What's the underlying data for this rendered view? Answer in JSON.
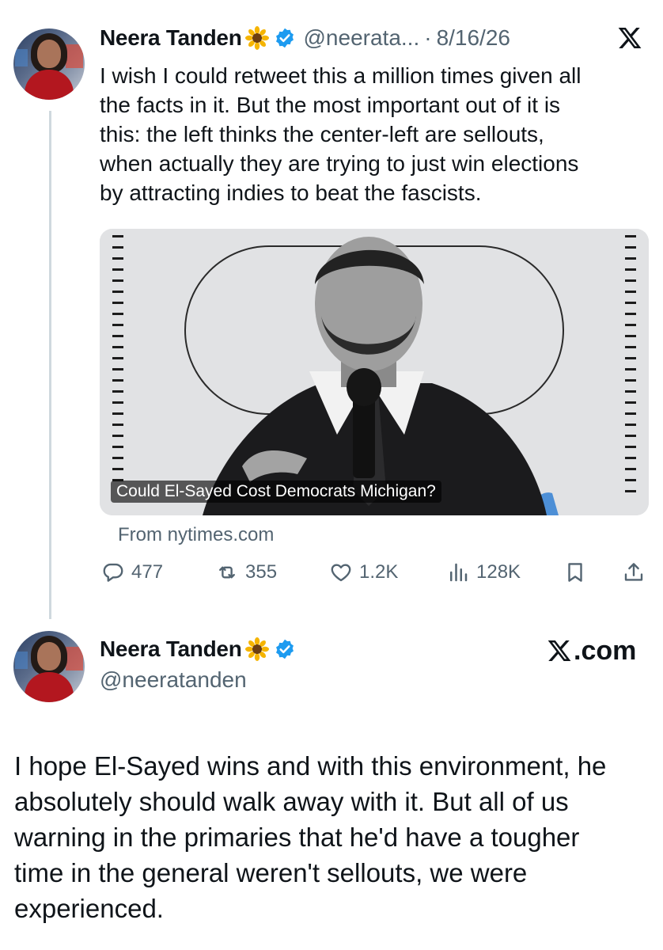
{
  "post": {
    "author_name": "Neera Tanden",
    "handle_truncated": "@neerata...",
    "separator": "·",
    "date": "8/16/26",
    "text_lines": [
      "I wish I could retweet this a million times given all",
      "the facts in it.  But the most important out of it is",
      "this: the left thinks the center-left are sellouts,",
      "when actually they are trying to just win elections",
      "by attracting indies to beat the fascists."
    ],
    "link_card": {
      "caption": "Could El-Sayed Cost Democrats Michigan?",
      "source": "From nytimes.com"
    },
    "stats": {
      "replies": "477",
      "reposts": "355",
      "likes": "1.2K",
      "views": "128K"
    }
  },
  "quoted_post": {
    "author_name": "Neera Tanden",
    "handle": "@neeratanden",
    "site_badge": ".com",
    "text_lines": [
      "I hope El-Sayed wins and with this environment, he",
      "absolutely should walk away with it.  But all of us",
      "warning in the primaries that he'd have a tougher",
      "time in the general weren't sellouts, we were",
      "experienced."
    ]
  },
  "icons": {
    "app_logo": "x-logo-icon",
    "verified": "verified-badge-icon",
    "emoji": "sunflower-icon",
    "reply": "reply-icon",
    "repost": "repost-icon",
    "like": "heart-icon",
    "views": "views-icon",
    "bookmark": "bookmark-icon",
    "share": "share-icon"
  },
  "colors": {
    "text": "#0f1419",
    "secondary_text": "#536471",
    "verified_blue": "#1d9bf0",
    "thread_line": "#cfd9de"
  }
}
